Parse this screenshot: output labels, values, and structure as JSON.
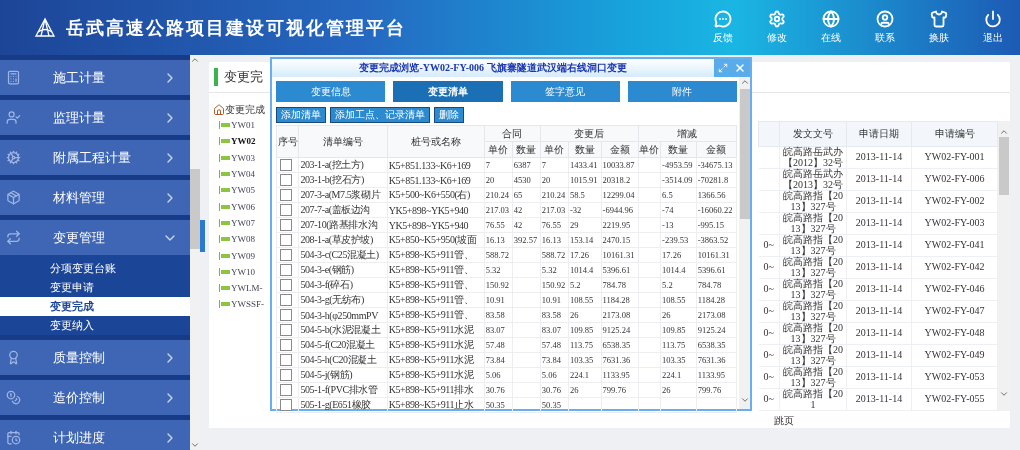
{
  "header": {
    "title": "岳武高速公路项目建设可视化管理平台",
    "actions": [
      {
        "label": "反馈"
      },
      {
        "label": "修改"
      },
      {
        "label": "在线"
      },
      {
        "label": "联系"
      },
      {
        "label": "换肤"
      },
      {
        "label": "退出"
      }
    ]
  },
  "sidebar": {
    "items": [
      {
        "label": "施工计量",
        "expanded": false
      },
      {
        "label": "监理计量",
        "expanded": false
      },
      {
        "label": "附属工程计量",
        "expanded": false
      },
      {
        "label": "材料管理",
        "expanded": false
      },
      {
        "label": "变更管理",
        "expanded": true,
        "children": [
          {
            "label": "分项变更台账",
            "selected": false
          },
          {
            "label": "变更申请",
            "selected": false
          },
          {
            "label": "变更完成",
            "selected": true
          },
          {
            "label": "变更纳入",
            "selected": false
          }
        ]
      },
      {
        "label": "质量控制",
        "expanded": false
      },
      {
        "label": "造价控制",
        "expanded": false
      },
      {
        "label": "计划进度",
        "expanded": false
      }
    ]
  },
  "panel": {
    "title": "变更完",
    "tree": {
      "label": "变更完成",
      "children": [
        {
          "label": "YW01",
          "selected": false
        },
        {
          "label": "YW02",
          "selected": true
        },
        {
          "label": "YW03",
          "selected": false
        },
        {
          "label": "YW04",
          "selected": false
        },
        {
          "label": "YW05",
          "selected": false
        },
        {
          "label": "YW06",
          "selected": false
        },
        {
          "label": "YW07",
          "selected": false
        },
        {
          "label": "YW08",
          "selected": false
        },
        {
          "label": "YW09",
          "selected": false
        },
        {
          "label": "YW10",
          "selected": false
        },
        {
          "label": "YWLM-",
          "selected": false
        },
        {
          "label": "YWSSF-",
          "selected": false
        }
      ]
    },
    "table": {
      "columns": [
        "发文文号",
        "申请日期",
        "申请编号"
      ],
      "rows": [
        {
          "doc_no": "皖高路岳武办【2012】32号",
          "date": "2013-11-14",
          "code": "YW02-FY-001"
        },
        {
          "doc_no": "皖高路岳武办【2013】32号",
          "date": "2013-11-14",
          "code": "YW02-FY-006"
        },
        {
          "doc_no": "皖高路指【2013】327号",
          "date": "2013-11-14",
          "code": "YW02-FY-002"
        },
        {
          "doc_no": "皖高路指【2013】327号",
          "date": "2013-11-14",
          "code": "YW02-FY-003"
        },
        {
          "column_1": "0~",
          "doc_no": "皖高路指【2013】327号",
          "date": "2013-11-14",
          "code": "YW02-FY-041"
        },
        {
          "column_1": "0~",
          "doc_no": "皖高路指【2013】327号",
          "date": "2013-11-14",
          "code": "YW02-FY-042"
        },
        {
          "column_1": "0~",
          "doc_no": "皖高路指【2013】327号",
          "date": "2013-11-14",
          "code": "YW02-FY-046"
        },
        {
          "column_1": "0~",
          "doc_no": "皖高路指【2013】327号",
          "date": "2013-11-14",
          "code": "YW02-FY-047"
        },
        {
          "column_1": "0~",
          "doc_no": "皖高路指【2013】327号",
          "date": "2013-11-14",
          "code": "YW02-FY-048"
        },
        {
          "column_1": "0~",
          "doc_no": "皖高路指【2013】327号",
          "date": "2013-11-14",
          "code": "YW02-FY-049"
        },
        {
          "column_1": "0~",
          "doc_no": "皖高路指【2013】327号",
          "date": "2013-11-14",
          "code": "YW02-FY-053"
        },
        {
          "column_1": "0~",
          "doc_no": "皖高路指【201",
          "date": "2013-11-14",
          "code": "YW02-FY-055"
        }
      ]
    },
    "pager": {
      "label": "跳页"
    }
  },
  "dialog": {
    "title": "变更完成浏览-YW02-FY-006 飞旗寨隧道武汉端右线洞口变更",
    "tabs": [
      {
        "label": "变更信息",
        "selected": false
      },
      {
        "label": "变更清单",
        "selected": true
      },
      {
        "label": "签字意见",
        "selected": false
      },
      {
        "label": "附件",
        "selected": false
      }
    ],
    "toolbar": [
      "添加清单",
      "添加工点、记录清单",
      "删除"
    ],
    "columns": [
      {
        "label": "序号"
      },
      {
        "label": "清单编号"
      },
      {
        "label": "桩号或名称"
      },
      {
        "label": "合同",
        "colspan": 2,
        "sub": [
          "单价",
          "数量"
        ]
      },
      {
        "label": "变更后",
        "colspan": 3,
        "sub": [
          "单价",
          "数量",
          "金额"
        ]
      },
      {
        "label": "增减",
        "colspan": 3,
        "sub": [
          "单价",
          "数量",
          "金额"
        ]
      }
    ],
    "rows": [
      {
        "checked": false,
        "cells": [
          "",
          "203-1-a(挖土方)",
          "K5+851.133~K6+169",
          "7",
          "6387",
          "7",
          "1433.41",
          "10033.87",
          "",
          "-4953.59",
          "-34675.13"
        ]
      },
      {
        "checked": false,
        "cells": [
          "",
          "203-1-b(挖石方)",
          "K5+851.133~K6+169",
          "20",
          "4530",
          "20",
          "1015.91",
          "20318.2",
          "",
          "-3514.09",
          "-70281.8"
        ]
      },
      {
        "checked": false,
        "cells": [
          "",
          "207-3-a(M7.5浆砌片",
          "K5+500~K6+550(右)",
          "210.24",
          "65",
          "210.24",
          "58.5",
          "12299.04",
          "",
          "6.5",
          "1366.56"
        ]
      },
      {
        "checked": false,
        "cells": [
          "",
          "207-7-a(盖板边沟",
          "YK5+898~YK5+940",
          "217.03",
          "42",
          "217.03",
          "-32",
          "-6944.96",
          "",
          "-74",
          "-16060.22"
        ]
      },
      {
        "checked": false,
        "cells": [
          "",
          "207-10(路基排水沟",
          "YK5+898~YK5+940",
          "76.55",
          "42",
          "76.55",
          "29",
          "2219.95",
          "",
          "-13",
          "-995.15"
        ]
      },
      {
        "checked": false,
        "cells": [
          "",
          "208-1-a(草皮护坡)",
          "K5+850~K5+950(坡面",
          "16.13",
          "392.57",
          "16.13",
          "153.14",
          "2470.15",
          "",
          "-239.53",
          "-3863.52"
        ]
      },
      {
        "checked": false,
        "cells": [
          "",
          "504-3-c(C25混凝土)",
          "K5+898~K5+911管、",
          "588.72",
          "",
          "588.72",
          "17.26",
          "10161.31",
          "",
          "17.26",
          "10161.31"
        ]
      },
      {
        "checked": false,
        "cells": [
          "",
          "504-3-e(钢筋)",
          "K5+898~K5+911管、",
          "5.32",
          "",
          "5.32",
          "1014.4",
          "5396.61",
          "",
          "1014.4",
          "5396.61"
        ]
      },
      {
        "checked": false,
        "cells": [
          "",
          "504-3-f(碎石)",
          "K5+898~K5+911管、",
          "150.92",
          "",
          "150.92",
          "5.2",
          "784.78",
          "",
          "5.2",
          "784.78"
        ]
      },
      {
        "checked": false,
        "cells": [
          "",
          "504-3-g(无纺布)",
          "K5+898~K5+911管、",
          "10.91",
          "",
          "10.91",
          "108.55",
          "1184.28",
          "",
          "108.55",
          "1184.28"
        ]
      },
      {
        "checked": false,
        "cells": [
          "",
          "504-3-h(φ250mmPV",
          "K5+898~K5+911管、",
          "83.58",
          "",
          "83.58",
          "26",
          "2173.08",
          "",
          "26",
          "2173.08"
        ]
      },
      {
        "checked": false,
        "cells": [
          "",
          "504-5-b(水泥混凝土",
          "K5+898~K5+911水泥",
          "83.07",
          "",
          "83.07",
          "109.85",
          "9125.24",
          "",
          "109.85",
          "9125.24"
        ]
      },
      {
        "checked": false,
        "cells": [
          "",
          "504-5-f(C20混凝土",
          "K5+898~K5+911水泥",
          "57.48",
          "",
          "57.48",
          "113.75",
          "6538.35",
          "",
          "113.75",
          "6538.35"
        ]
      },
      {
        "checked": false,
        "cells": [
          "",
          "504-5-h(C20混凝土",
          "K5+898~K5+911水泥",
          "73.84",
          "",
          "73.84",
          "103.35",
          "7631.36",
          "",
          "103.35",
          "7631.36"
        ]
      },
      {
        "checked": false,
        "cells": [
          "",
          "504-5-j(钢筋)",
          "K5+898~K5+911水泥",
          "5.06",
          "",
          "5.06",
          "224.1",
          "1133.95",
          "",
          "224.1",
          "1133.95"
        ]
      },
      {
        "checked": false,
        "cells": [
          "",
          "505-1-f(PVC排水管",
          "K5+898~K5+911排水",
          "30.76",
          "",
          "30.76",
          "26",
          "799.76",
          "",
          "26",
          "799.76"
        ]
      },
      {
        "checked": false,
        "cells": [
          "",
          "505-1-g(E651橡胶",
          "K5+898~K5+911止水",
          "50.35",
          "",
          "50.35",
          "",
          "",
          "",
          "",
          ""
        ]
      }
    ]
  }
}
